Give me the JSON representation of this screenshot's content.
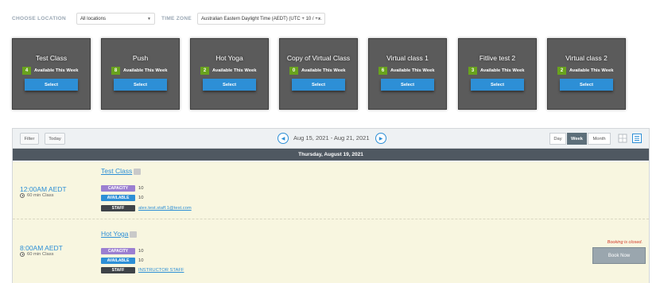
{
  "filters": {
    "location_label": "CHOOSE LOCATION",
    "location_value": "All locations",
    "timezone_label": "TIME ZONE",
    "timezone_value": "Australian Eastern Daylight Time (AEDT) (UTC + 10 / +..."
  },
  "cards": [
    {
      "title": "Test Class",
      "count": "4",
      "available_text": "Available This Week",
      "button": "Select"
    },
    {
      "title": "Push",
      "count": "8",
      "available_text": "Available This Week",
      "button": "Select"
    },
    {
      "title": "Hot Yoga",
      "count": "2",
      "available_text": "Available This Week",
      "button": "Select"
    },
    {
      "title": "Copy of Virtual Class",
      "count": "0",
      "available_text": "Available This Week",
      "button": "Select"
    },
    {
      "title": "Virtual class 1",
      "count": "6",
      "available_text": "Available This Week",
      "button": "Select"
    },
    {
      "title": "Fitlive test 2",
      "count": "3",
      "available_text": "Available This Week",
      "button": "Select"
    },
    {
      "title": "Virtual class 2",
      "count": "2",
      "available_text": "Available This Week",
      "button": "Select"
    }
  ],
  "toolbar": {
    "filter_label": "Filter",
    "today_label": "Today",
    "date_range": "Aug 15, 2021 - Aug 21, 2021",
    "view_day": "Day",
    "view_week": "Week",
    "view_month": "Month",
    "active_view": "Week"
  },
  "schedule": {
    "date_heading": "Thursday, August 19, 2021",
    "sessions": [
      {
        "time": "12:00AM AEDT",
        "duration": "60 min Class",
        "class_name": "Test Class",
        "capacity_label": "CAPACITY",
        "capacity": "10",
        "available_label": "AVAILABLE",
        "available": "10",
        "staff_label": "STAFF",
        "staff": "alex.test.staff.1@test.com"
      },
      {
        "time": "8:00AM AEDT",
        "duration": "60 min Class",
        "class_name": "Hot Yoga",
        "capacity_label": "CAPACITY",
        "capacity": "10",
        "available_label": "AVAILABLE",
        "available": "10",
        "staff_label": "STAFF",
        "staff": "INSTRUCTOR STAFF",
        "status": "Booking is closed.",
        "book_label": "Book Now"
      }
    ]
  },
  "colors": {
    "accent": "#2d8fd6",
    "count_badge": "#69a31d",
    "capacity_tag": "#9b7fd1",
    "closed_text": "#d23a2a"
  }
}
